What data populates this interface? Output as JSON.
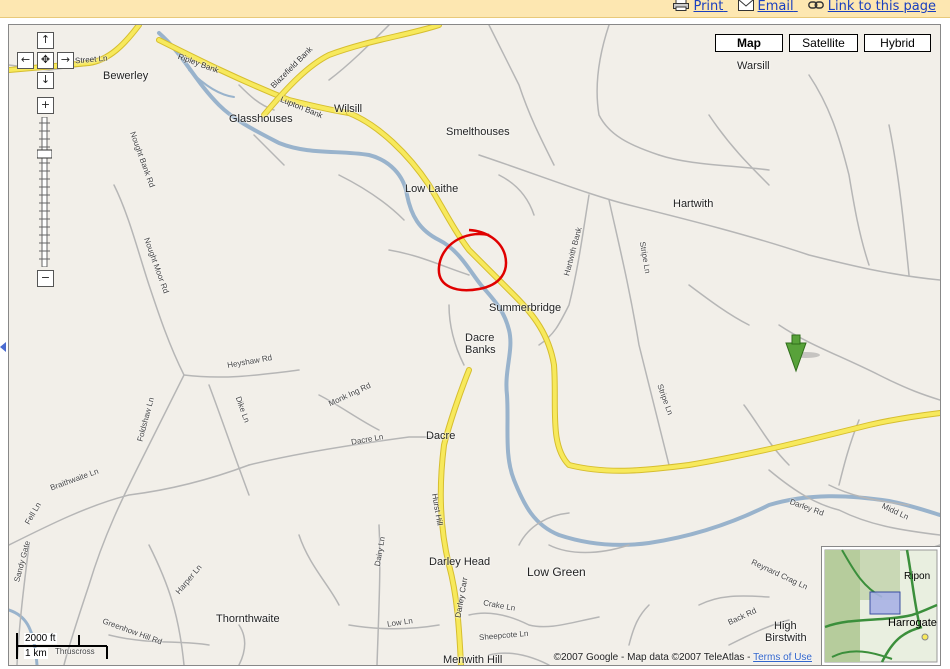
{
  "toolbar": {
    "print_label": "Print",
    "email_label": "Email",
    "link_label": "Link to this page"
  },
  "map_types": {
    "map": "Map",
    "satellite": "Satellite",
    "hybrid": "Hybrid",
    "active": "Map"
  },
  "places": {
    "bewerley": "Bewerley",
    "glasshouses": "Glasshouses",
    "wilsill": "Wilsill",
    "smelthouses": "Smelthouses",
    "low_laithe": "Low Laithe",
    "warsill": "Warsill",
    "hartwith": "Hartwith",
    "summerbridge": "Summerbridge",
    "dacre_banks_1": "Dacre",
    "dacre_banks_2": "Banks",
    "dacre": "Dacre",
    "darley_head": "Darley Head",
    "low_green": "Low Green",
    "thornthwaite": "Thornthwaite",
    "high_birstwith_1": "High",
    "high_birstwith_2": "Birstwith",
    "menwith_hill": "Menwith Hill",
    "thruscross": "Thruscross"
  },
  "roads": {
    "street_ln": "Street Ln",
    "ripley_bank": "Ripley Bank",
    "blazefield_bank": "Blazefield Bank",
    "lupton_bank": "Lupton Bank",
    "nought_bank_rd": "Nought Bank Rd",
    "nought_moor_rd": "Nought Moor Rd",
    "hartwith_bank": "Hartwith Bank",
    "stripe_ln_1": "Stripe Ln",
    "stripe_ln_2": "Stripe Ln",
    "heyshaw_rd": "Heyshaw Rd",
    "foldshaw_ln": "Foldshaw Ln",
    "dike_ln": "Dike Ln",
    "monk_ing_rd": "Monk Ing Rd",
    "dacre_ln": "Dacre Ln",
    "braithwaite_ln": "Braithwaite Ln",
    "fell_ln": "Fell Ln",
    "hurst_hill": "Hurst Hill",
    "darley_carr": "Darley Carr",
    "dairy_ln": "Dairy Ln",
    "crake_ln": "Crake Ln",
    "sheepcote_ln": "Sheepcote Ln",
    "low_ln": "Low Ln",
    "harper_ln": "Harper Ln",
    "greenhow_hill_rd": "Greenhow Hill Rd",
    "reynard_crag_ln": "Reynard Crag Ln",
    "back_rd": "Back Rd",
    "darley_rd": "Darley Rd",
    "midd_ln": "Midd Ln",
    "sandy_gate": "Sandy Gate"
  },
  "scale": {
    "imperial": "2000 ft",
    "metric": "1 km"
  },
  "copyright": {
    "text": "©2007 Google - Map data ©2007 TeleAtlas - ",
    "terms": "Terms of Use"
  },
  "overview": {
    "ripon": "Ripon",
    "harrogate": "Harrogate"
  },
  "colors": {
    "land": "#f2efe9",
    "major_road": "#f7e95c",
    "major_road_edge": "#d6be2f",
    "minor_road": "#b6b6b6",
    "river": "#99b3cc",
    "annotation_circle": "#e00000",
    "marker": "#58a23a"
  },
  "icons": {
    "print": "printer-icon",
    "email": "envelope-icon",
    "link": "chain-link-icon",
    "marker": "green-arrow-marker-icon"
  }
}
